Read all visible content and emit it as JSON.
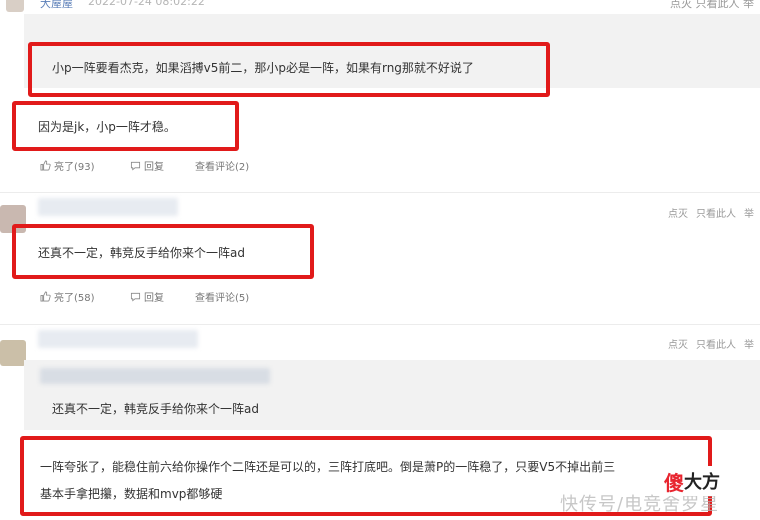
{
  "top_comment": {
    "username": "大屋屋",
    "time": "2022-07-24 08:02:22",
    "actions": "点灭  只看此人  举"
  },
  "comment1": {
    "quote": "小p一阵要看杰克，如果滔搏v5前二，那小p必是一阵，如果有rng那就不好说了",
    "reply": "因为是jk，小p一阵才稳。",
    "like": "亮了(93)",
    "reply_btn": "回复",
    "view": "查看评论(2)"
  },
  "comment2": {
    "side_actions": [
      "点灭",
      "只看此人",
      "举"
    ],
    "text": "还真不一定，韩竞反手给你来个一阵ad",
    "like": "亮了(58)",
    "reply_btn": "回复",
    "view": "查看评论(5)"
  },
  "comment3": {
    "side_actions": [
      "点灭",
      "只看此人",
      "举"
    ],
    "quote": "还真不一定，韩竞反手给你来个一阵ad",
    "reply_line1": "一阵夸张了，能稳住前六给你操作个二阵还是可以的，三阵打底吧。倒是萧P的一阵稳了，只要V5不掉出前三",
    "reply_line2": "基本手拿把攥，数据和mvp都够硬"
  },
  "watermark": "快传号/电竞舍罗星",
  "logo": {
    "mark": "傻",
    "text": "大方"
  },
  "colors": {
    "highlight": "#e11a1a",
    "quote_bg": "#f2f2f2",
    "username": "#5b7fb8"
  },
  "icons": [
    "thumbs-up-icon",
    "reply-icon"
  ]
}
